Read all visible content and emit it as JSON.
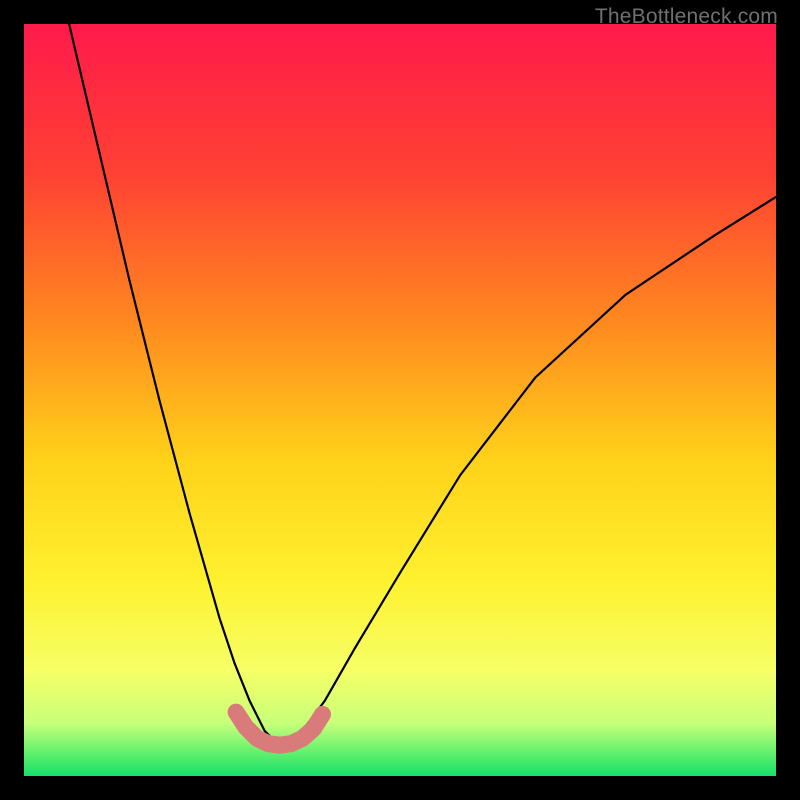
{
  "watermark": "TheBottleneck.com",
  "chart_data": {
    "type": "line",
    "title": "",
    "xlabel": "",
    "ylabel": "",
    "xlim": [
      0,
      100
    ],
    "ylim": [
      0,
      100
    ],
    "note": "Bottleneck-style V curve. No axis ticks or numeric labels are shown; x and y are relative 0-100. Minimum (optimal point) near x≈34.",
    "series": [
      {
        "name": "bottleneck-curve",
        "x": [
          6,
          10,
          14,
          18,
          22,
          26,
          28,
          30,
          32,
          33.5,
          35,
          37,
          40,
          44,
          50,
          58,
          68,
          80,
          92,
          100
        ],
        "values": [
          100,
          83,
          66,
          50,
          35,
          21,
          15,
          10,
          6,
          4.5,
          4.6,
          6,
          10,
          17,
          27,
          40,
          53,
          64,
          72,
          77
        ]
      }
    ],
    "highlight_band": {
      "name": "optimal-range-marker",
      "color": "#d97b7b",
      "x": [
        28.2,
        29.5,
        31,
        32.5,
        34,
        35.5,
        37,
        38.5,
        39.7
      ],
      "values": [
        8.5,
        6.5,
        5.0,
        4.3,
        4.1,
        4.3,
        5.0,
        6.3,
        8.2
      ]
    },
    "gradient_stops": [
      {
        "offset": 0.0,
        "color": "#ff1a4b"
      },
      {
        "offset": 0.2,
        "color": "#ff4133"
      },
      {
        "offset": 0.4,
        "color": "#ff8a1f"
      },
      {
        "offset": 0.58,
        "color": "#ffd21a"
      },
      {
        "offset": 0.74,
        "color": "#fff12f"
      },
      {
        "offset": 0.86,
        "color": "#f6ff66"
      },
      {
        "offset": 0.93,
        "color": "#c7ff7a"
      },
      {
        "offset": 0.965,
        "color": "#6cf26e"
      },
      {
        "offset": 1.0,
        "color": "#16e06a"
      }
    ]
  }
}
